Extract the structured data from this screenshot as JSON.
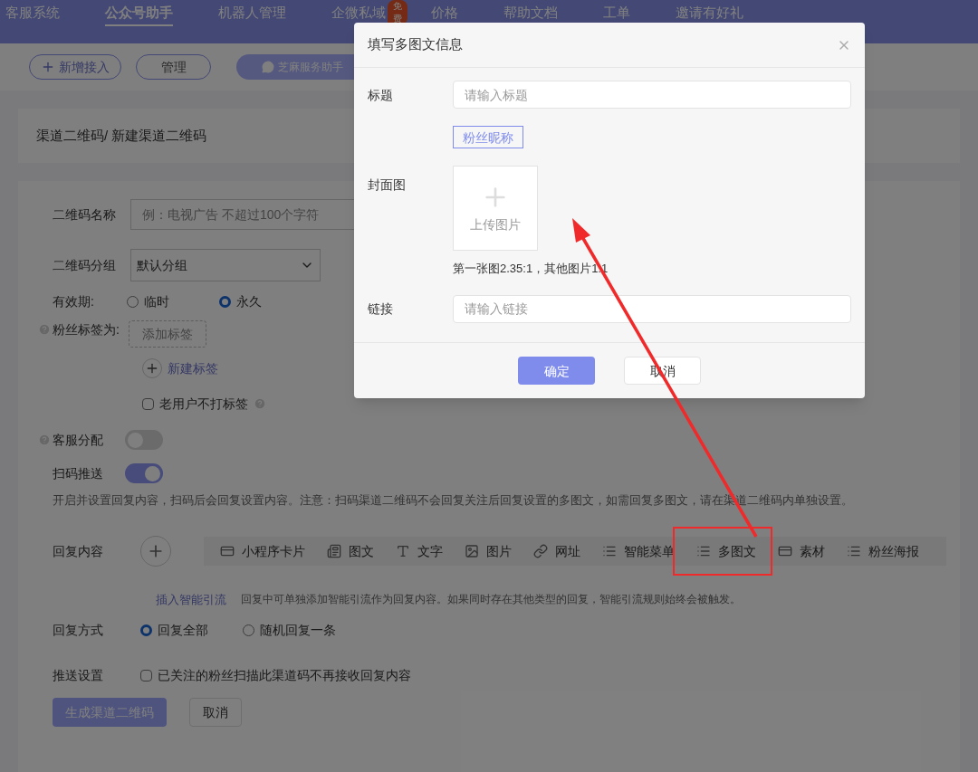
{
  "nav": {
    "items": [
      {
        "label": "客服系统",
        "selected": false
      },
      {
        "label": "公众号助手",
        "selected": true
      },
      {
        "label": "机器人管理",
        "selected": false
      },
      {
        "label": "企微私域",
        "selected": false,
        "badge": "免费"
      },
      {
        "label": "价格",
        "selected": false
      },
      {
        "label": "帮助文档",
        "selected": false
      },
      {
        "label": "工单",
        "selected": false
      },
      {
        "label": "邀请有好礼",
        "selected": false
      }
    ]
  },
  "toolbar": {
    "buttons": [
      {
        "label": "新增接入",
        "kind": "add"
      },
      {
        "label": "管理",
        "kind": "outline"
      },
      {
        "label": "芝麻服务助手",
        "kind": "account"
      }
    ]
  },
  "breadcrumb": "渠道二维码/ 新建渠道二维码",
  "form": {
    "name": {
      "label": "二维码名称",
      "placeholder": "例：电视广告 不超过100个字符"
    },
    "group": {
      "label": "二维码分组",
      "value": "默认分组"
    },
    "validity": {
      "label": "有效期:",
      "options": [
        {
          "label": "临时",
          "selected": false
        },
        {
          "label": "永久",
          "selected": true
        }
      ]
    },
    "fan_tags": {
      "label": "粉丝标签为:",
      "add_button": "添加标签",
      "new_link": "新建标签",
      "skip_old": {
        "label": "老用户不打标签",
        "checked": false
      }
    },
    "service_assign": {
      "label": "客服分配",
      "on": false
    },
    "scan_push": {
      "label": "扫码推送",
      "on": true,
      "note": "开启并设置回复内容，扫码后会回复设置内容。注意：扫码渠道二维码不会回复关注后回复设置的多图文，如需回复多图文，请在渠道二维码内单独设置。"
    },
    "reply_content": {
      "label": "回复内容",
      "types": [
        {
          "label": "小程序卡片",
          "highlighted": false
        },
        {
          "label": "图文",
          "highlighted": false
        },
        {
          "label": "文字",
          "highlighted": false
        },
        {
          "label": "图片",
          "highlighted": false
        },
        {
          "label": "网址",
          "highlighted": false
        },
        {
          "label": "智能菜单",
          "highlighted": false
        },
        {
          "label": "多图文",
          "highlighted": true
        },
        {
          "label": "素材",
          "highlighted": false
        },
        {
          "label": "粉丝海报",
          "highlighted": false
        }
      ]
    },
    "smart_flow": {
      "link": "插入智能引流",
      "description": "回复中可单独添加智能引流作为回复内容。如果同时存在其他类型的回复，智能引流规则始终会被触发。"
    },
    "reply_mode": {
      "label": "回复方式",
      "options": [
        {
          "label": "回复全部",
          "selected": true
        },
        {
          "label": "随机回复一条",
          "selected": false
        }
      ]
    },
    "push_setting": {
      "label": "推送设置",
      "checkbox": {
        "label": "已关注的粉丝扫描此渠道码不再接收回复内容",
        "checked": false
      }
    },
    "actions": [
      "生成渠道二维码",
      "取消"
    ]
  },
  "dialog": {
    "title": "填写多图文信息",
    "title_field": {
      "label": "标题",
      "placeholder": "请输入标题"
    },
    "tag": "粉丝昵称",
    "cover": {
      "label": "封面图",
      "upload": "上传图片",
      "hint": "第一张图2.35:1，其他图片1:1"
    },
    "link_field": {
      "label": "链接",
      "placeholder": "请输入链接"
    },
    "buttons": [
      "确定",
      "取消"
    ]
  }
}
